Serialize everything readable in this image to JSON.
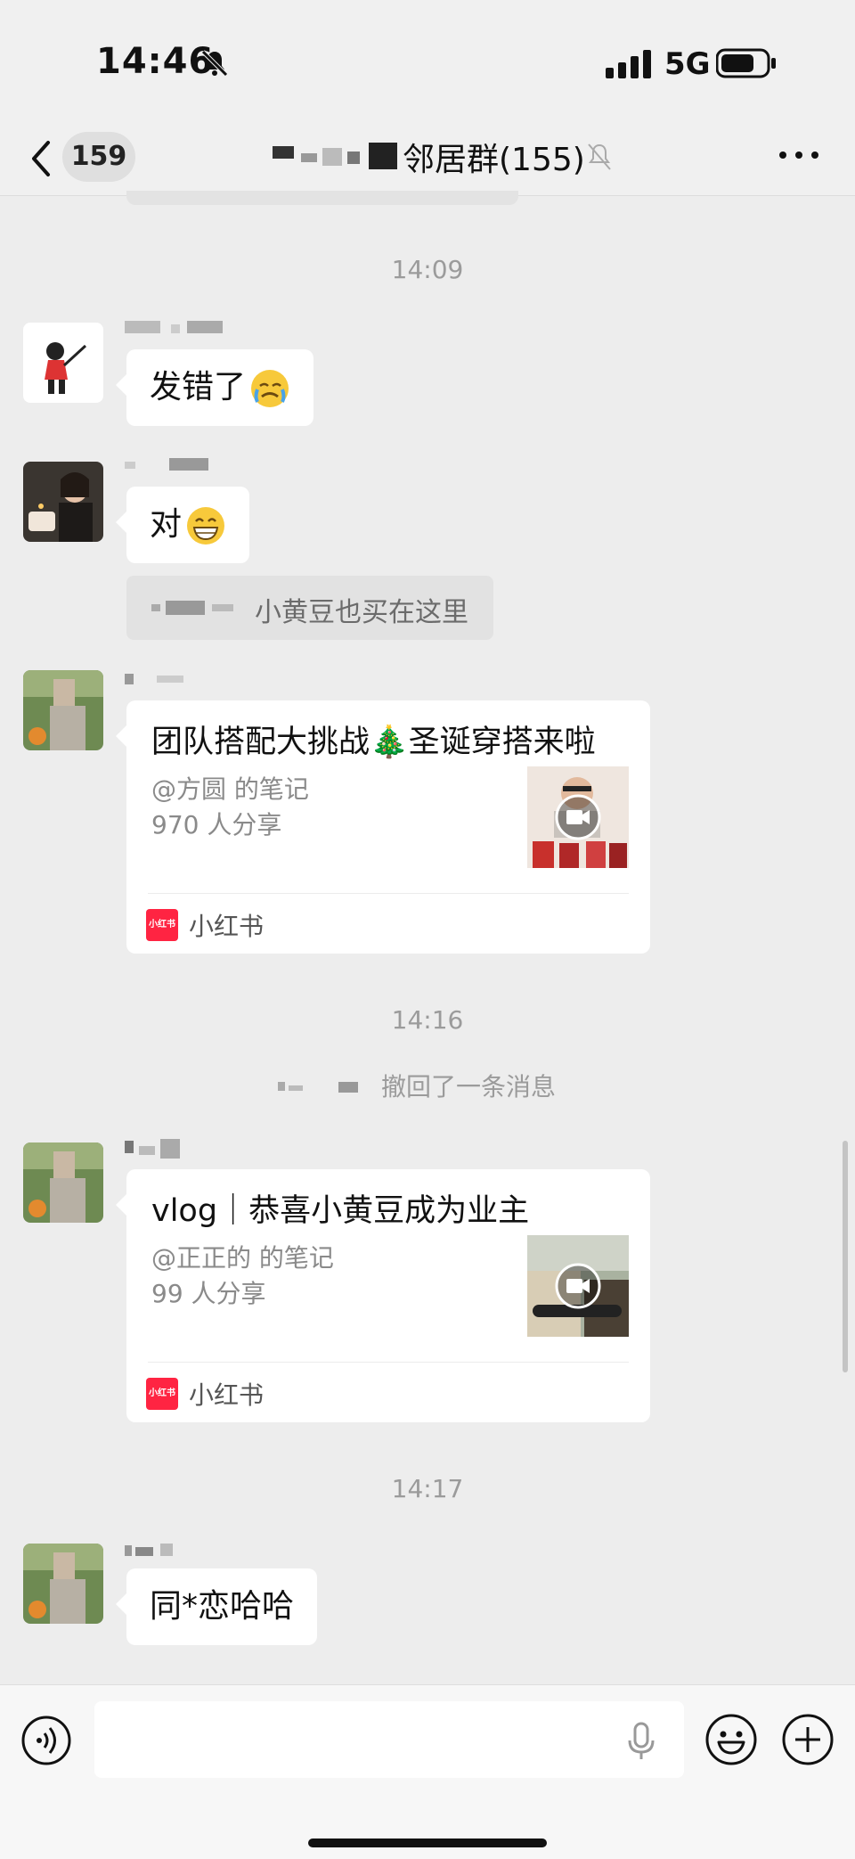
{
  "status_bar": {
    "time": "14:46",
    "network": "5G"
  },
  "nav": {
    "unread_count": "159",
    "title": "邻居群(155)"
  },
  "messages": {
    "divider_1": "14:09",
    "msg_1_text": "发错了",
    "msg_2_text": "对",
    "quote_text": "小黄豆也买在这里",
    "card_1": {
      "title": "团队搭配大挑战🎄圣诞穿搭来啦",
      "author": "@方圆 的笔记",
      "shares": "970 人分享",
      "source": "小红书",
      "logo_text": "小红书"
    },
    "divider_2": "14:16",
    "recall_text": "撤回了一条消息",
    "card_2": {
      "title": "vlog｜恭喜小黄豆成为业主",
      "author": "@正正的 的笔记",
      "shares": "99 人分享",
      "source": "小红书",
      "logo_text": "小红书"
    },
    "divider_3": "14:17",
    "msg_3_text": "同*恋哈哈"
  },
  "colors": {
    "background": "#ededed",
    "bubble": "#ffffff",
    "xhs_red": "#ff2442",
    "timestamp": "#9b9b9b"
  }
}
